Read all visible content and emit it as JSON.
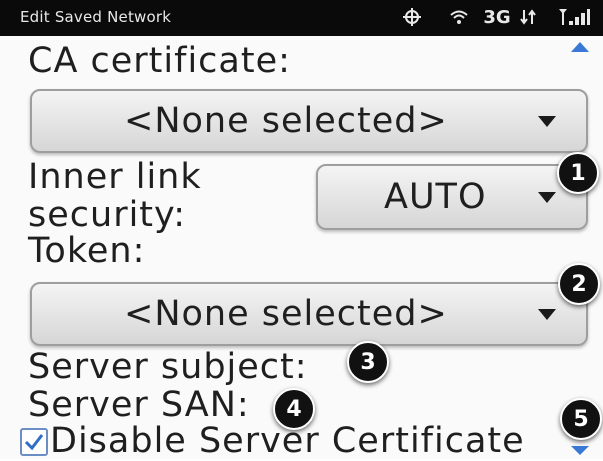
{
  "status_bar": {
    "title": "Edit Saved Network",
    "network_label": "3G",
    "gps_icon": "gps-crosshair-icon",
    "wifi_icon": "wifi-signal-icon",
    "transfer_icon": "data-transfer-icon",
    "signal_icon": "cell-signal-icon"
  },
  "form": {
    "ca_certificate_label": "CA certificate:",
    "ca_certificate_value": "<None selected>",
    "inner_link_label_line1": "Inner link",
    "inner_link_label_line2": "security:",
    "inner_link_value": "AUTO",
    "token_label": "Token:",
    "token_value": "<None selected>",
    "server_subject_label": "Server subject:",
    "server_san_label": "Server SAN:",
    "disable_cert_label": "Disable Server Certificate",
    "disable_cert_checked": true
  },
  "callouts": [
    "1",
    "2",
    "3",
    "4",
    "5"
  ],
  "colors": {
    "status_bg": "#0a0a0a",
    "accent_blue": "#3a78d6",
    "badge_bg": "#111111"
  }
}
